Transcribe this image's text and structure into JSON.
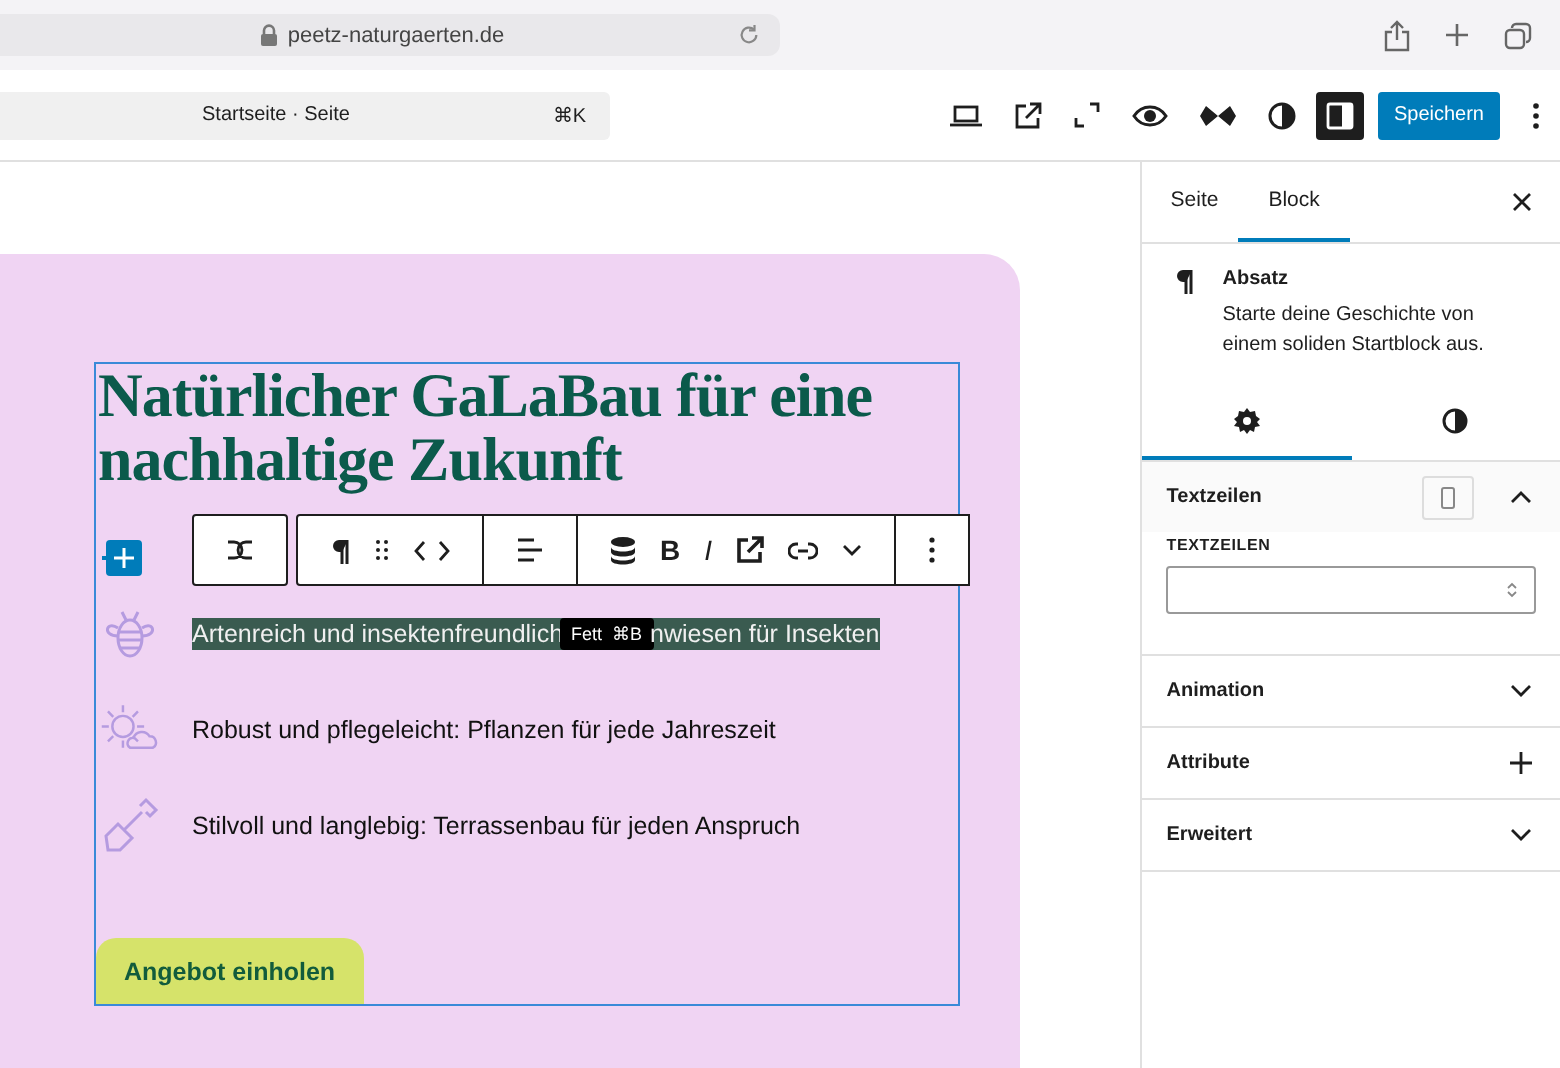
{
  "browser": {
    "url": "peetz-naturgaerten.de"
  },
  "editor_header": {
    "command_bar": {
      "label": "Startseite · Seite",
      "shortcut": "⌘K"
    },
    "save_button": "Speichern",
    "sidebar_toggle": {
      "on": true
    }
  },
  "canvas": {
    "heading": "Natürlicher GaLaBau für eine nachhaltige Zukunft",
    "toolbar": {
      "bold": "B",
      "italic": "I",
      "tooltip": {
        "label": "Fett",
        "shortcut": "⌘B"
      }
    },
    "items": [
      {
        "kind": "bee",
        "selected": true,
        "text_before": "Artenreich und insektenfreundlich",
        "text_after": "nwiesen für Insekten"
      },
      {
        "kind": "weather",
        "selected": false,
        "text_before": "Robust und pflegeleicht: Pflanzen für jede Jahreszeit"
      },
      {
        "kind": "shovel",
        "selected": false,
        "text_before": "Stilvoll und langlebig: Terrassenbau für jeden Anspruch"
      }
    ],
    "button": "Angebot einholen"
  },
  "sidebar": {
    "tabs": [
      {
        "label": "Seite",
        "selected": false
      },
      {
        "label": "Block",
        "selected": true
      }
    ],
    "block": {
      "title": "Absatz",
      "description": "Starte deine Geschichte von einem soliden Startblock aus."
    },
    "subtabs": [
      {
        "kind": "settings",
        "selected": true
      },
      {
        "kind": "styles",
        "selected": false
      }
    ],
    "panels": [
      {
        "title": "Textzeilen",
        "expanded": true,
        "kind": "chevron",
        "field_label": "TEXTZEILEN"
      },
      {
        "title": "Animation",
        "expanded": false,
        "kind": "chevron"
      },
      {
        "title": "Attribute",
        "expanded": false,
        "kind": "plus"
      },
      {
        "title": "Erweitert",
        "expanded": false,
        "kind": "chevron"
      }
    ]
  }
}
